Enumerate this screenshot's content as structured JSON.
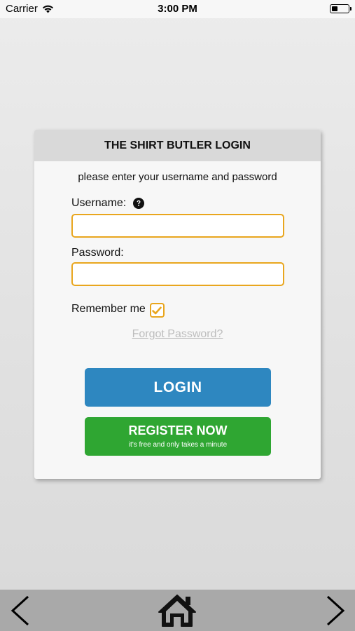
{
  "status_bar": {
    "carrier": "Carrier",
    "time": "3:00 PM"
  },
  "login": {
    "title": "THE SHIRT BUTLER LOGIN",
    "instructions": "please enter your username and password",
    "username_label": "Username:",
    "username_value": "",
    "password_label": "Password:",
    "password_value": "",
    "remember_label": "Remember me",
    "remember_checked": true,
    "forgot_label": "Forgot Password?",
    "login_button": "LOGIN",
    "register_button": "REGISTER NOW",
    "register_subtitle": "it's free and only takes a minute"
  },
  "colors": {
    "accent_border": "#e9a61e",
    "login_blue": "#2e87c0",
    "register_green": "#2fa632"
  },
  "nav": {
    "icons": [
      "back-arrow-icon",
      "home-icon",
      "forward-arrow-icon"
    ]
  }
}
